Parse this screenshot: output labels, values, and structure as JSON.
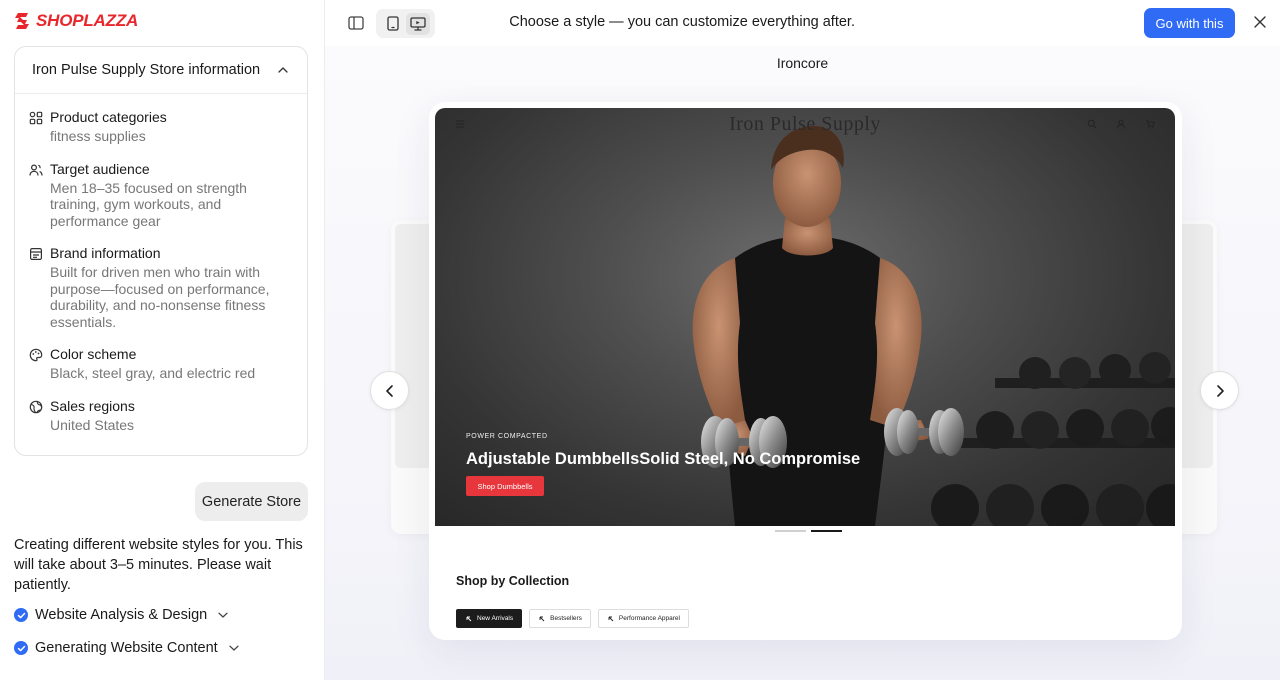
{
  "brand": {
    "logo_text": "SHOPLAZZA",
    "accent": "#e8262b",
    "primary": "#2f6bf5"
  },
  "info_card": {
    "title": "Iron Pulse Supply Store information",
    "items": [
      {
        "icon": "categories-icon",
        "label": "Product categories",
        "value": "fitness supplies"
      },
      {
        "icon": "audience-icon",
        "label": "Target audience",
        "value": "Men 18–35 focused on strength training, gym workouts, and performance gear"
      },
      {
        "icon": "brand-icon",
        "label": "Brand information",
        "value": "Built for driven men who train with purpose—focused on performance, durability, and no-nonsense fitness essentials."
      },
      {
        "icon": "palette-icon",
        "label": "Color scheme",
        "value": "Black, steel gray, and electric red"
      },
      {
        "icon": "globe-icon",
        "label": "Sales regions",
        "value": "United States"
      }
    ]
  },
  "generate_button": "Generate Store",
  "status_text": "Creating different website styles for you. This will take about 3–5 minutes. Please wait patiently.",
  "steps": [
    {
      "label": "Website Analysis & Design"
    },
    {
      "label": "Generating Website Content"
    }
  ],
  "topbar": {
    "prompt": "Choose a style — you can customize everything after.",
    "go_button": "Go with this"
  },
  "preview": {
    "theme_name": "Ironcore",
    "store_name": "Iron Pulse Supply",
    "hero": {
      "eyebrow": "POWER COMPACTED",
      "title": "Adjustable DumbbellsSolid Steel, No Compromise",
      "cta": "Shop Dumbbells"
    },
    "carousel_active_index": 2,
    "collection_title": "Shop by Collection",
    "chips": [
      "New Arrivals",
      "Bestsellers",
      "Performance Apparel"
    ]
  }
}
